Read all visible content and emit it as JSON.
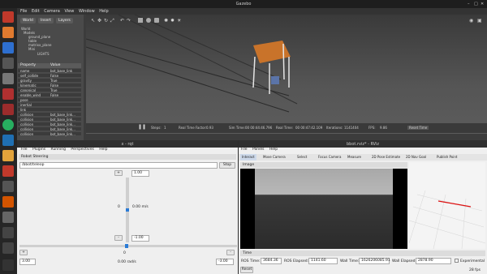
{
  "topbar": {
    "title": "Gazebo"
  },
  "gazebo": {
    "menu": [
      "File",
      "Edit",
      "Camera",
      "View",
      "Window",
      "Help"
    ],
    "tabs": [
      "World",
      "Insert",
      "Layers"
    ],
    "tree": [
      "World",
      "Models",
      "ground_plane",
      "table",
      "matrixx_plane",
      "Mini",
      "LIGHTS"
    ],
    "prop_headers": {
      "property": "Property",
      "value": "Value"
    },
    "props": [
      {
        "name": "name",
        "value": "bot_base_link"
      },
      {
        "name": "self_collide",
        "value": "False"
      },
      {
        "name": "gravity",
        "value": "True"
      },
      {
        "name": "kinematic",
        "value": "False"
      },
      {
        "name": "canonical",
        "value": "True"
      },
      {
        "name": "enable_wind",
        "value": "False"
      },
      {
        "name": "pose",
        "value": ""
      },
      {
        "name": "inertial",
        "value": ""
      },
      {
        "name": "link",
        "value": ""
      },
      {
        "name": "collision",
        "value": "bot_base_link..."
      },
      {
        "name": "collision",
        "value": "bot_base_link..."
      },
      {
        "name": "collision",
        "value": "bot_base_link..."
      },
      {
        "name": "collision",
        "value": "bot_base_link..."
      },
      {
        "name": "collision",
        "value": "bot_base_link..."
      }
    ],
    "status": {
      "steps_label": "Steps:",
      "steps_value": "1",
      "rtf_label": "Real Time Factor:",
      "rtf_value": "0.93",
      "sim_label": "Sim Time:",
      "sim_value": "00 00:44:46.796",
      "real_label": "Real Time:",
      "real_value": "00 00:47:42.109",
      "iter_label": "Iterations:",
      "iter_value": "1141404",
      "fps_label": "FPS:",
      "fps_value": "9.86",
      "reset": "Reset Time"
    }
  },
  "rqt": {
    "title": "x - rqt",
    "menu": [
      "File",
      "Plugins",
      "Running",
      "Perspectives",
      "Help"
    ],
    "plugin": "Robot Steering",
    "topic": "/bbot/teleop",
    "stop": "Stop",
    "plus": "+",
    "minus": "-",
    "lin_max": "1.00",
    "lin_zero": "0",
    "lin_value": "0.00 m/s",
    "lin_min": "-1.00",
    "ang_zero": "0",
    "ang_value": "0.00 rad/s",
    "ang_left": "3.00",
    "ang_right": "-3.00"
  },
  "rviz": {
    "title": "bbot.rviz* - RViz",
    "menu": [
      "File",
      "Panels",
      "Help"
    ],
    "tools": [
      "Interact",
      "Move Camera",
      "Select",
      "Focus Camera",
      "Measure",
      "2D Pose Estimate",
      "2D Nav Goal",
      "Publish Point"
    ],
    "image_panel": "Image",
    "time_panel": "Time",
    "ros_time_label": "ROS Time:",
    "ros_time": "3684.36",
    "ros_elapsed_label": "ROS Elapsed:",
    "ros_elapsed": "1141.60",
    "wall_time_label": "Wall Time:",
    "wall_time": "1626206085.91",
    "wall_elapsed_label": "Wall Elapsed:",
    "wall_elapsed": "2878.90",
    "experimental": "Experimental",
    "reset": "Reset",
    "fps": "28 fps"
  }
}
